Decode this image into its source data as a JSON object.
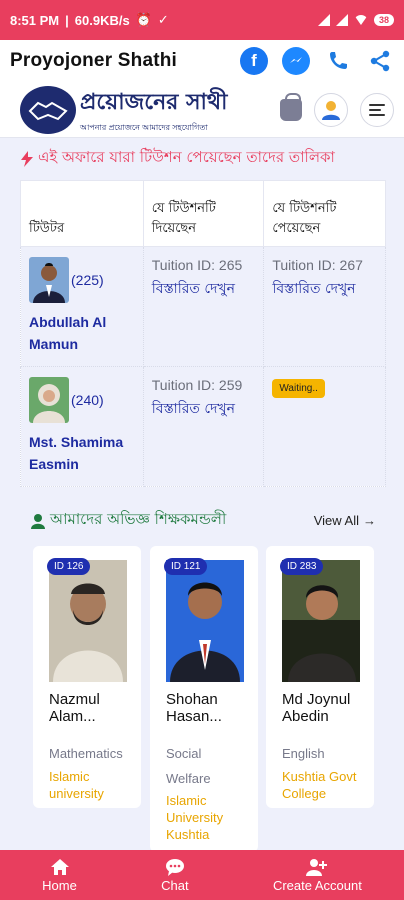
{
  "status_bar": {
    "time": "8:51 PM",
    "speed": "60.9KB/s",
    "battery": "38"
  },
  "header": {
    "title": "Proyojoner Shathi",
    "icons": [
      "facebook-icon",
      "messenger-icon",
      "phone-icon",
      "share-icon"
    ]
  },
  "logo": {
    "main_text": "প্রয়োজনের সাথী",
    "sub_text": "আপনার প্রয়োজনে আমাদের সহযোগিতা"
  },
  "list_title": "এই অফারে যারা টিউশন পেয়েছেন তাদের তালিকা",
  "table": {
    "headers": [
      "টিউটর",
      "যে টিউশনটি দিয়েছেন",
      "যে টিউশনটি পেয়েছেন"
    ],
    "rows": [
      {
        "count": "(225)",
        "name": "Abdullah Al Mamun",
        "given_id": "Tuition ID: 265",
        "given_link": "বিস্তারিত দেখুন",
        "received_id": "Tuition ID: 267",
        "received_link": "বিস্তারিত দেখুন"
      },
      {
        "count": "(240)",
        "name": "Mst. Shamima Easmin",
        "given_id": "Tuition ID: 259",
        "given_link": "বিস্তারিত দেখুন",
        "received_status": "Waiting.."
      }
    ]
  },
  "teachers": {
    "title": "আমাদের অভিজ্ঞ শিক্ষকমন্ডলী",
    "view_all": "View All",
    "cards": [
      {
        "id": "ID 126",
        "name": "Nazmul Alam...",
        "subject": "Mathematics",
        "university": "Islamic university"
      },
      {
        "id": "ID 121",
        "name": "Shohan Hasan...",
        "subject": "Social Welfare",
        "university": "Islamic University Kushtia"
      },
      {
        "id": "ID 283",
        "name": "Md Joynul Abedin",
        "subject": "English",
        "university": "Kushtia Govt College"
      }
    ]
  },
  "bottom_nav": {
    "items": [
      {
        "label": "Home",
        "icon": "home-icon"
      },
      {
        "label": "Chat",
        "icon": "chat-icon"
      },
      {
        "label": "Create Account",
        "icon": "add-user-icon"
      }
    ]
  },
  "colors": {
    "accent": "#e83e5e",
    "link": "#1e2ba0",
    "badge": "#1f2fb0",
    "waiting": "#f5b400",
    "university": "#e8a500",
    "section_title": "#1f7a3f"
  }
}
